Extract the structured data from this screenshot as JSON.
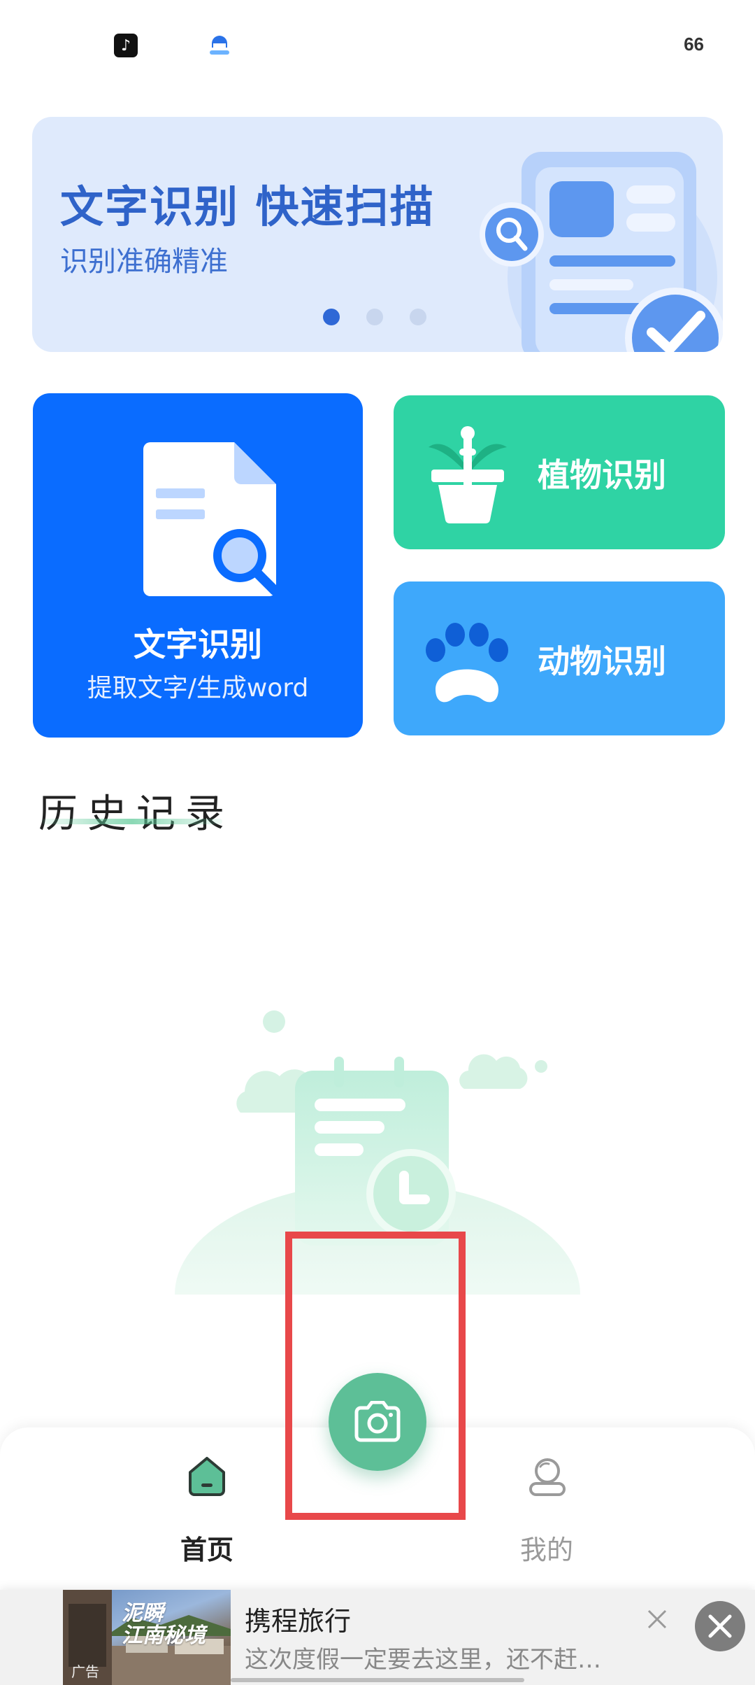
{
  "status_bar": {
    "apps": [
      "tiktok-icon",
      "app-shield-icon"
    ],
    "battery": "66"
  },
  "banner": {
    "title": "文字识别 快速扫描",
    "subtitle": "识别准确精准",
    "slides_total": 3,
    "active_slide": 1
  },
  "features": {
    "text": {
      "title": "文字识别",
      "subtitle": "提取文字/生成word"
    },
    "plant": {
      "title": "植物识别"
    },
    "animal": {
      "title": "动物识别"
    }
  },
  "history": {
    "title": "历史记录"
  },
  "bottom_nav": {
    "home_label": "首页",
    "mine_label": "我的",
    "active": "home"
  },
  "ad": {
    "title": "携程旅行",
    "description": "这次度假一定要去这里，还不赶…",
    "image_text_line1": "泥瞬",
    "image_text_line2": "江南秘境",
    "tag": "广告"
  },
  "colors": {
    "primary_blue": "#0a6cff",
    "plant_green": "#2fd3a4",
    "animal_blue": "#3ea8fb",
    "fab_green": "#5dbf97",
    "highlight_red": "#e8484a"
  }
}
